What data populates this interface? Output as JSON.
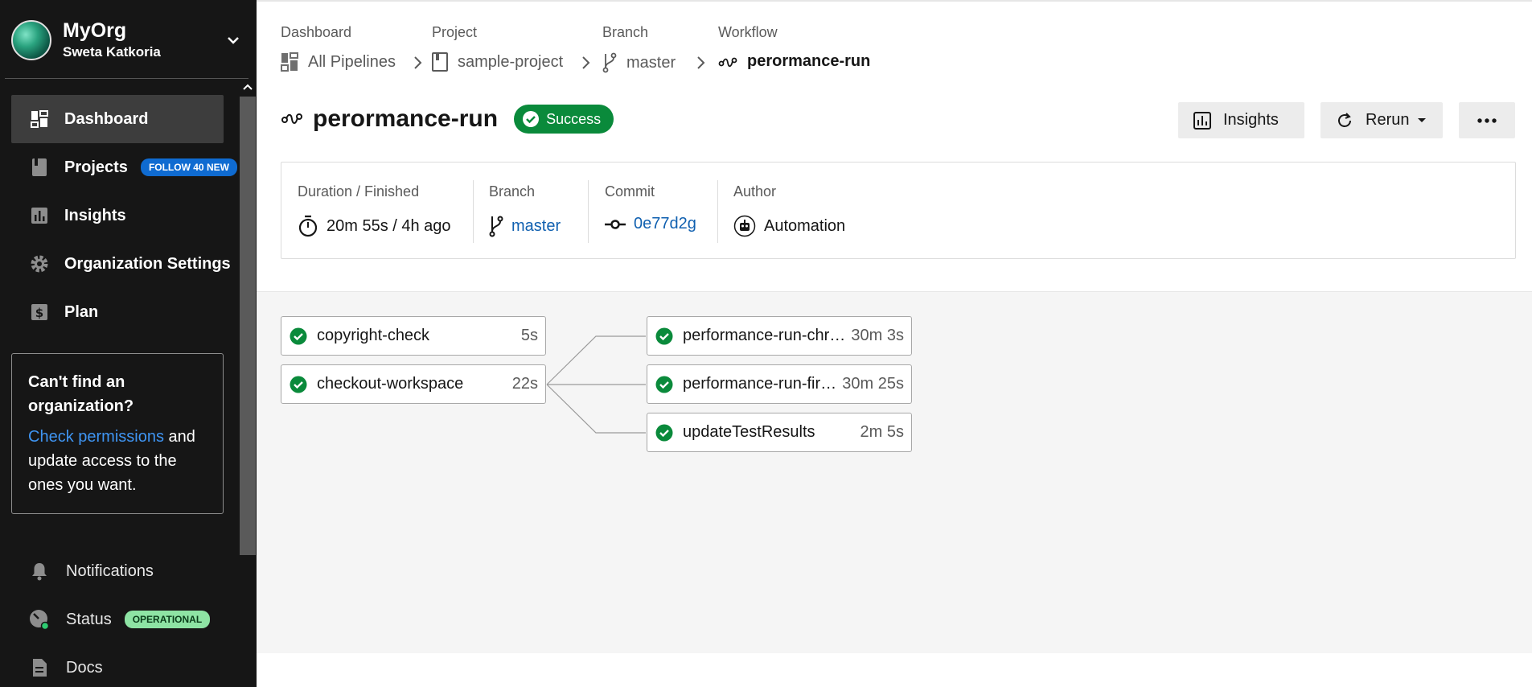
{
  "org": {
    "name": "MyOrg",
    "user": "Sweta Katkoria"
  },
  "nav": [
    {
      "label": "Dashboard",
      "icon": "dashboard-icon",
      "active": true
    },
    {
      "label": "Projects",
      "icon": "book-icon",
      "badge": "FOLLOW 40 NEW"
    },
    {
      "label": "Insights",
      "icon": "bar-chart-icon"
    },
    {
      "label": "Organization Settings",
      "icon": "gear-icon"
    },
    {
      "label": "Plan",
      "icon": "dollar-icon"
    }
  ],
  "org_card": {
    "title": "Can't find an organization?",
    "link": "Check permissions",
    "text": " and update access to the ones you want."
  },
  "bottom_nav": [
    {
      "label": "Notifications",
      "icon": "bell-icon"
    },
    {
      "label": "Status",
      "icon": "status-icon",
      "badge": "OPERATIONAL"
    },
    {
      "label": "Docs",
      "icon": "document-icon"
    }
  ],
  "breadcrumb": [
    {
      "label": "Dashboard",
      "value": "All Pipelines"
    },
    {
      "label": "Project",
      "value": "sample-project"
    },
    {
      "label": "Branch",
      "value": "master"
    },
    {
      "label": "Workflow",
      "value": "perormance-run"
    }
  ],
  "workflow": {
    "title": "perormance-run",
    "status": "Success"
  },
  "actions": {
    "insights": "Insights",
    "rerun": "Rerun"
  },
  "info": {
    "duration_label": "Duration / Finished",
    "duration_value": "20m 55s / 4h ago",
    "branch_label": "Branch",
    "branch_value": "master",
    "commit_label": "Commit",
    "commit_value": "0e77d2g",
    "author_label": "Author",
    "author_value": "Automation"
  },
  "jobs": [
    {
      "name": "copyright-check",
      "duration": "5s",
      "status": "success"
    },
    {
      "name": "checkout-workspace",
      "duration": "22s",
      "status": "success"
    },
    {
      "name": "performance-run-chrome",
      "duration": "30m 3s",
      "status": "success"
    },
    {
      "name": "performance-run-firefox",
      "duration": "30m 25s",
      "status": "success"
    },
    {
      "name": "updateTestResults",
      "duration": "2m 5s",
      "status": "success"
    }
  ],
  "colors": {
    "success": "#0a8a3b",
    "link": "#1060b0",
    "sidebar": "#161616",
    "badge_blue": "#0f6bd1",
    "badge_green": "#8ee4a4"
  }
}
